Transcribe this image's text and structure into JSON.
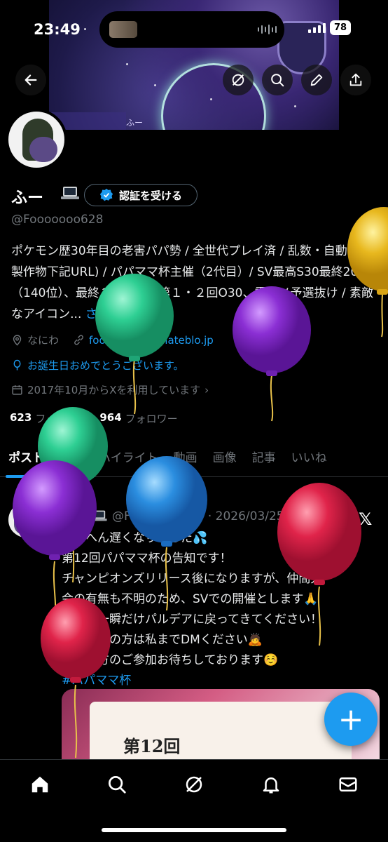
{
  "status_bar": {
    "time": "23:49",
    "battery": "78"
  },
  "banner": {
    "tag": "ふー"
  },
  "profile": {
    "name": "ふー",
    "verify_label": "認証を受ける",
    "handle": "@Fooooooo628",
    "bio": "ポケモン歴30年目の老害パパ勢 / 全世代プレイ済 / 乱数・自動化勢製作物下記URL) / パパママ杯主催（2代目）/ SV最高S30最終2012（140位）、最終３桁数回 / 第１・２回O30、雷撃Ｖ予選抜け / 素敵なアイコン...",
    "bio_more": "さらに表示",
    "location": "なにわ",
    "website": "fooooooo628.hateblo.jp",
    "birthday": "お誕生日おめでとうございます。",
    "joined": "2017年10月からXを利用しています",
    "following_count": "623",
    "following_label": "フォロー中",
    "followers_count": "964",
    "followers_label": "フォロワー"
  },
  "tabs": [
    "ポスト",
    "返信",
    "ハイライト",
    "動画",
    "画像",
    "記事",
    "いいね"
  ],
  "post": {
    "pinned_label": "固定",
    "author": "ふー",
    "handle_date": "@Fooooooo628 · 2026/03/25",
    "lines": [
      "たいへん遅くなりました💦",
      "第12回パパママ杯の告知です！",
      "チャンピオンズリリース後になりますが、仲間大",
      "会の有無も不明のため、SVでの開催とします🙏",
      "この日一瞬だけパルデアに戻ってきてください！",
      "参加希望の方は私までDMください🙇",
      "沢山の方のご参加お待ちしております☺️"
    ],
    "hashtag": "#パパママ杯",
    "image_title": "第12回"
  },
  "fab_label": "+",
  "colors": {
    "accent": "#1d9bf0",
    "background": "#000000",
    "muted": "#71767b"
  },
  "icons": [
    "back-icon",
    "grok-icon",
    "search-icon",
    "edit-icon",
    "share-icon",
    "home-icon",
    "notifications-icon",
    "messages-icon"
  ]
}
